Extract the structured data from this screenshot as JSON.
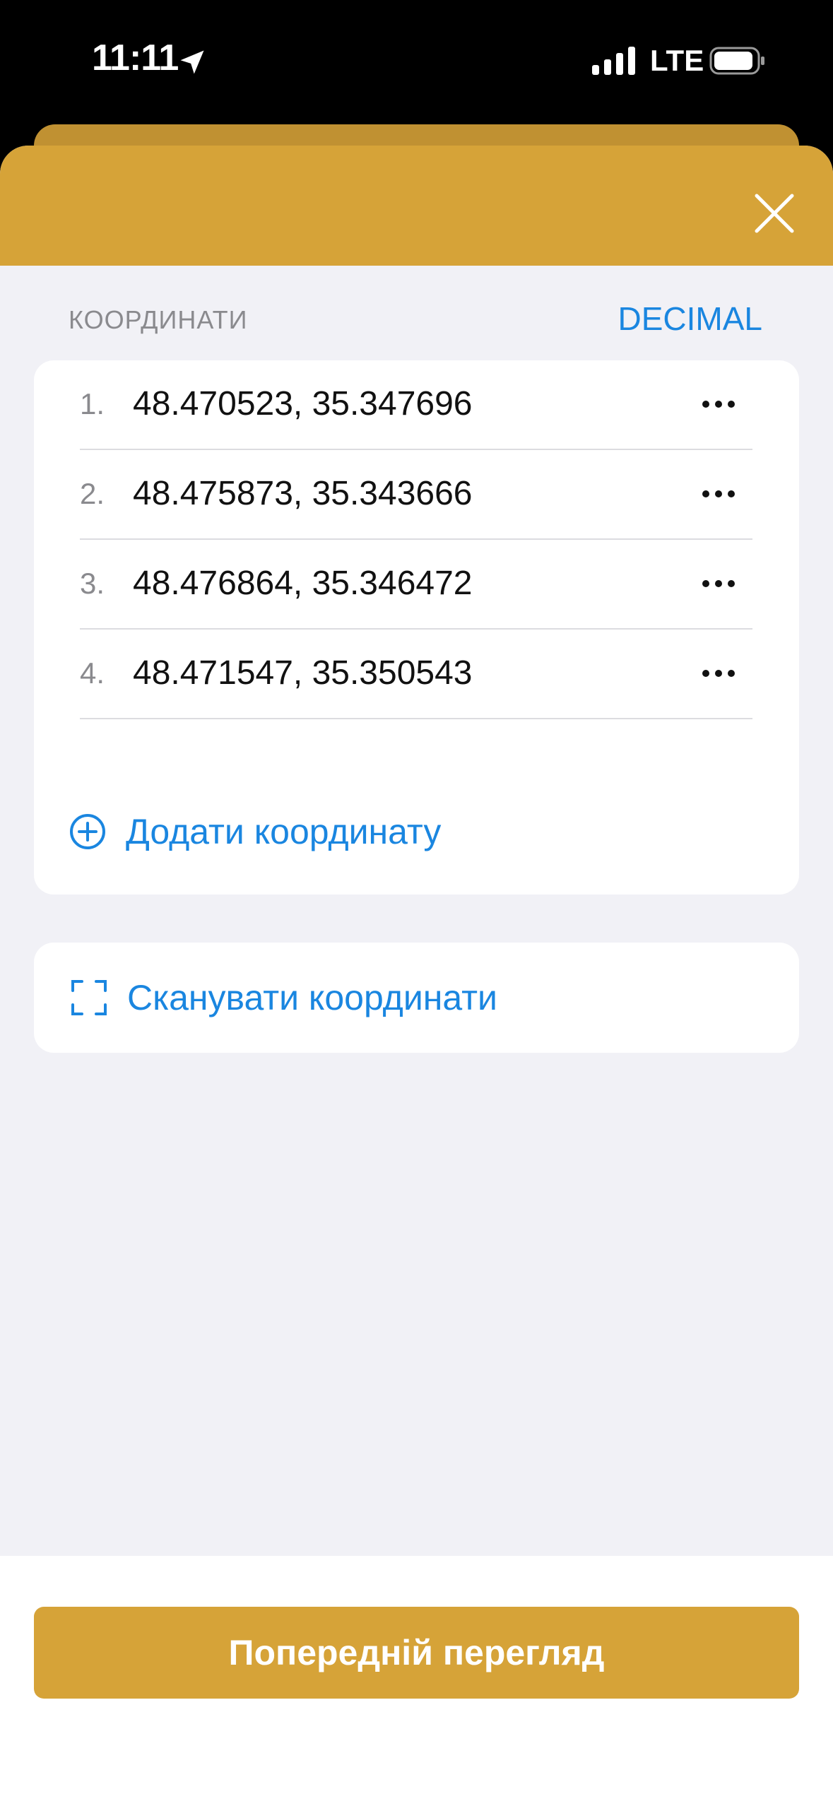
{
  "status_bar": {
    "time": "11:11",
    "network": "LTE",
    "icons": [
      "location-arrow-icon",
      "signal-icon",
      "battery-icon"
    ]
  },
  "header": {
    "close_icon": "close-icon",
    "color": "#d6a338"
  },
  "section": {
    "label": "КООРДИНАТИ",
    "format_toggle": "DECIMAL"
  },
  "coordinates": [
    {
      "index": "1.",
      "value": "48.470523, 35.347696"
    },
    {
      "index": "2.",
      "value": "48.475873, 35.343666"
    },
    {
      "index": "3.",
      "value": "48.476864, 35.346472"
    },
    {
      "index": "4.",
      "value": "48.471547, 35.350543"
    }
  ],
  "actions": {
    "add_coordinate": "Додати координату",
    "scan_coordinates": "Сканувати координати"
  },
  "footer": {
    "preview_button": "Попередній перегляд"
  },
  "colors": {
    "accent": "#d6a338",
    "link": "#1a86e0",
    "background": "#f1f1f6"
  }
}
